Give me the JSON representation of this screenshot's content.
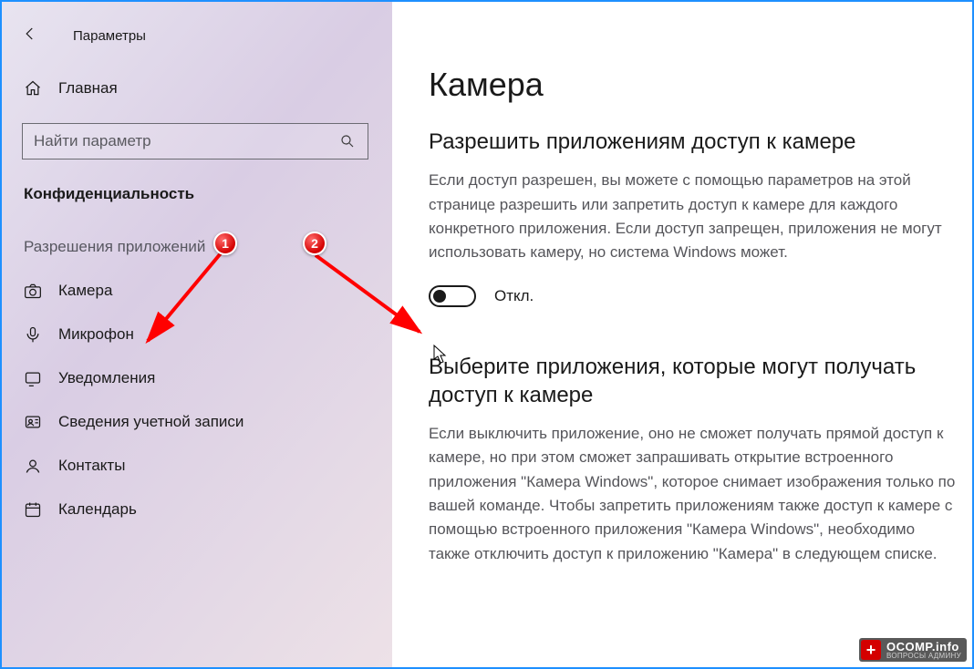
{
  "window": {
    "title": "Параметры"
  },
  "sidebar": {
    "home": "Главная",
    "search_placeholder": "Найти параметр",
    "category": "Конфиденциальность",
    "group": "Разрешения приложений",
    "items": [
      {
        "icon": "camera",
        "label": "Камера"
      },
      {
        "icon": "mic",
        "label": "Микрофон"
      },
      {
        "icon": "bell",
        "label": "Уведомления"
      },
      {
        "icon": "account",
        "label": "Сведения учетной записи"
      },
      {
        "icon": "contacts",
        "label": "Контакты"
      },
      {
        "icon": "calendar",
        "label": "Календарь"
      }
    ]
  },
  "main": {
    "heading": "Камера",
    "section1_title": "Разрешить приложениям доступ к камере",
    "section1_body": "Если доступ разрешен, вы можете с помощью параметров на этой странице разрешить или запретить доступ к камере для каждого конкретного приложения. Если доступ запрещен, приложения не могут использовать камеру, но система Windows может.",
    "toggle_state": "off",
    "toggle_label": "Откл.",
    "section2_title": "Выберите приложения, которые могут получать доступ к камере",
    "section2_body": "Если выключить приложение, оно не сможет получать прямой доступ к камере, но при этом сможет запрашивать открытие встроенного приложения \"Камера Windows\", которое снимает изображения только по вашей команде. Чтобы запретить приложениям также доступ к камере с помощью встроенного приложения \"Камера Windows\", необходимо также отключить доступ к приложению \"Камера\" в следующем списке."
  },
  "annotation": {
    "badges": [
      "1",
      "2"
    ]
  },
  "watermark": {
    "site": "OCOMP.info",
    "tag": "ВОПРОСЫ АДМИНУ"
  }
}
